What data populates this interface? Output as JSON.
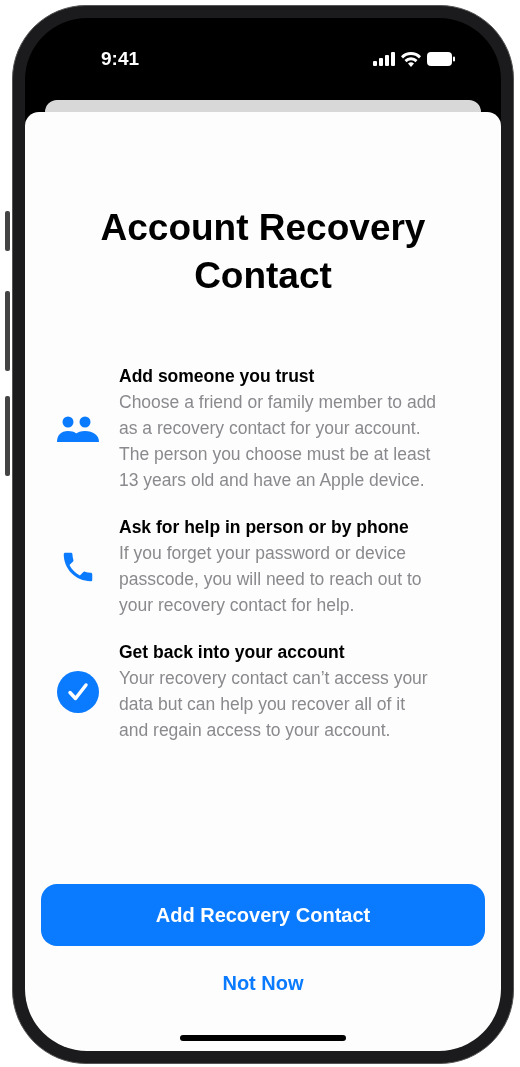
{
  "status_bar": {
    "time": "9:41"
  },
  "title": "Account Recovery Contact",
  "features": [
    {
      "kind": "people",
      "heading": "Add someone you trust",
      "body": "Choose a friend or family member to add as a recovery contact for your account. The person you choose must be at least 13 years old and have an Apple device."
    },
    {
      "kind": "phone",
      "heading": "Ask for help in person or by phone",
      "body": "If you forget your password or device passcode, you will need to reach out to your recovery contact for help."
    },
    {
      "kind": "check",
      "heading": "Get back into your account",
      "body": "Your recovery contact can’t access your data but can help you recover all of it and regain access to your account."
    }
  ],
  "primary_button": "Add Recovery Contact",
  "secondary_button": "Not Now"
}
